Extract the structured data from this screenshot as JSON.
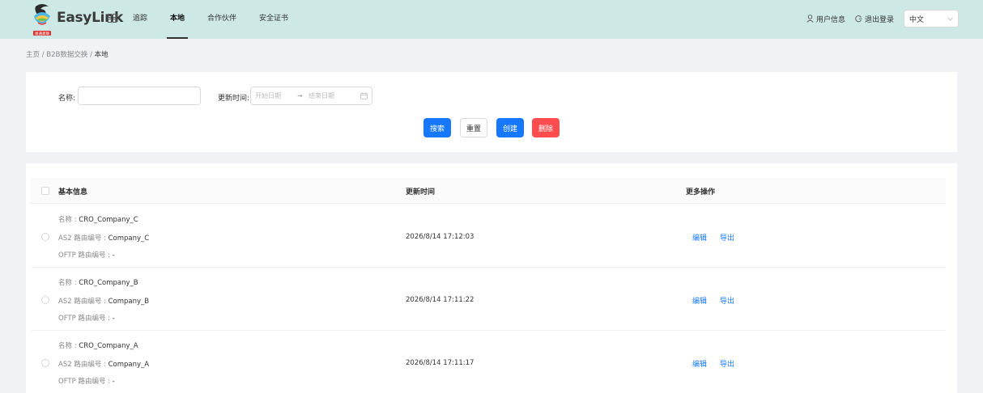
{
  "header": {
    "logo_caption": "易通易联",
    "brand": "EasyLink",
    "nav": [
      "追踪",
      "本地",
      "合作伙伴",
      "安全证书"
    ],
    "active_nav": 1,
    "user_info": "用户信息",
    "logout": "退出登录",
    "language": "中文"
  },
  "breadcrumb": {
    "home": "主页",
    "section": "B2B数据交换",
    "current": "本地",
    "separator": " / "
  },
  "search": {
    "name_label": "名称:",
    "name_value": "",
    "time_label": "更新时间:",
    "start_placeholder": "开始日期",
    "end_placeholder": "结束日期",
    "range_arrow": "→",
    "buttons": {
      "search": "搜索",
      "reset": "重置",
      "create": "创建",
      "delete": "删除"
    }
  },
  "table": {
    "headers": [
      "基本信息",
      "更新时间",
      "更多操作"
    ],
    "field_labels": {
      "name": "名称 : ",
      "as2": "AS2 路由编号 : ",
      "oftp": "OFTP 路由编号 : "
    },
    "ops": {
      "edit": "编辑",
      "export": "导出"
    },
    "rows": [
      {
        "name": "CRO_Company_C",
        "as2": "Company_C",
        "oftp": "-",
        "updated": "2026/8/14 17:12:03"
      },
      {
        "name": "CRO_Company_B",
        "as2": "Company_B",
        "oftp": "-",
        "updated": "2026/8/14 17:11:22"
      },
      {
        "name": "CRO_Company_A",
        "as2": "Company_A",
        "oftp": "-",
        "updated": "2026/8/14 17:11:17"
      }
    ]
  },
  "colors": {
    "header_bg": "#cde8e5",
    "primary": "#1677ff",
    "danger": "#ff4d4f",
    "page_bg": "#f0f2f5"
  }
}
